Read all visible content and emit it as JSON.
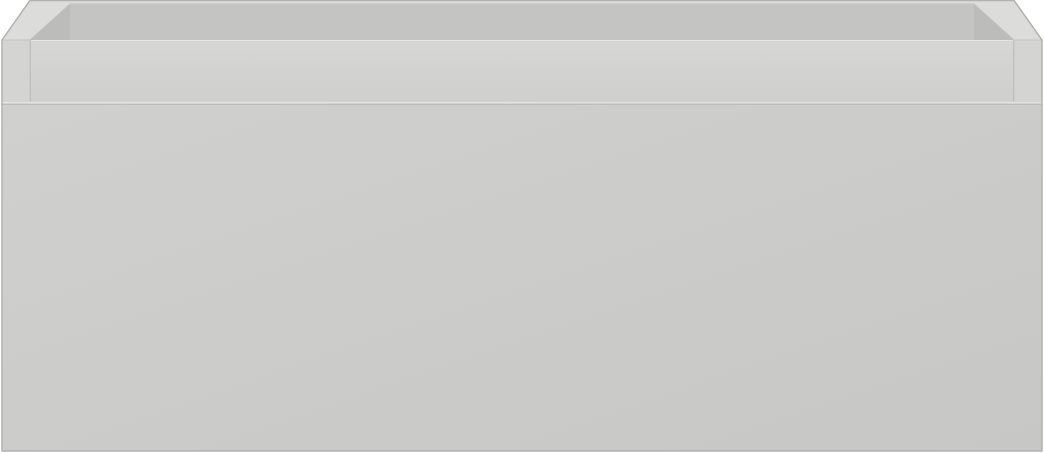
{
  "object": {
    "name": "drawer-unit",
    "colors": {
      "body": "#cdcdcb",
      "body_shade": "#c6c6c4",
      "inner_back": "#c3c3c1",
      "inner_top_rim": "#d6d6d4",
      "inner_side": "#bdbdbb",
      "rim_face": "#d2d2d0",
      "rim_highlight": "#e3e3e1",
      "edge_line": "#bebebc",
      "outline": "#b4b4b2",
      "background": "#ffffff"
    }
  }
}
